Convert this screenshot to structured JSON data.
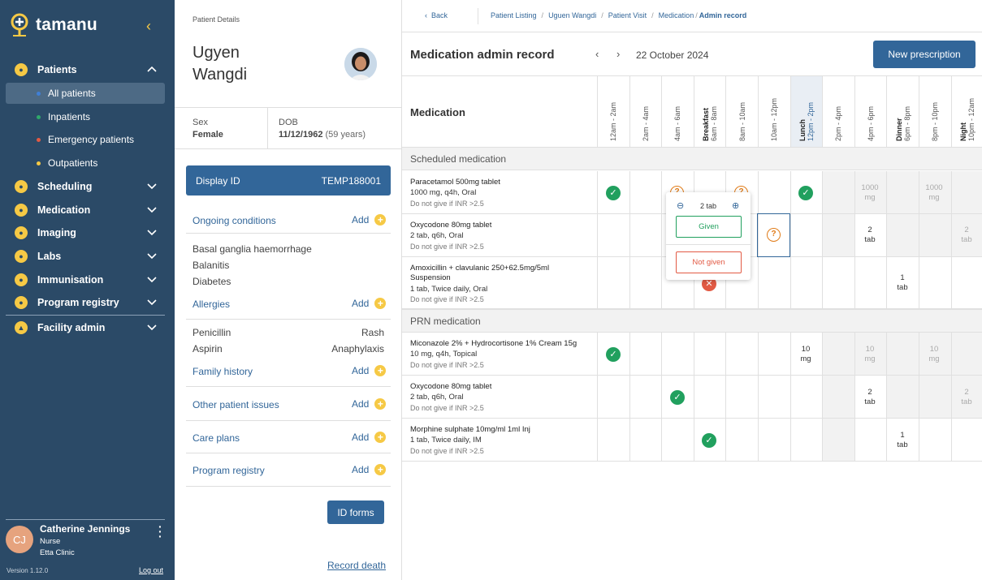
{
  "sidebar": {
    "brand": "tamanu",
    "items": [
      {
        "label": "Patients"
      },
      {
        "label": "Scheduling"
      },
      {
        "label": "Medication"
      },
      {
        "label": "Imaging"
      },
      {
        "label": "Labs"
      },
      {
        "label": "Immunisation"
      },
      {
        "label": "Program registry"
      },
      {
        "label": "Facility admin"
      }
    ],
    "patient_subitems": [
      {
        "label": "All patients",
        "dot_color": "#3f7fd6"
      },
      {
        "label": "Inpatients",
        "dot_color": "#2fa86a"
      },
      {
        "label": "Emergency patients",
        "dot_color": "#e25a44"
      },
      {
        "label": "Outpatients",
        "dot_color": "#f6c945"
      }
    ],
    "user": {
      "initials": "CJ",
      "name": "Catherine Jennings",
      "role": "Nurse",
      "clinic": "Etta Clinic"
    },
    "version": "Version 1.12.0",
    "logout": "Log out"
  },
  "patient": {
    "section_label": "Patient Details",
    "first_name": "Ugyen",
    "last_name": "Wangdi",
    "sex_label": "Sex",
    "sex": "Female",
    "dob_label": "DOB",
    "dob": "11/12/1962",
    "age": "(59 years)",
    "display_id_label": "Display ID",
    "display_id": "TEMP188001",
    "add_label": "Add",
    "ongoing_conditions_title": "Ongoing conditions",
    "conditions": [
      "Basal ganglia haemorrhage",
      "Balanitis",
      "Diabetes"
    ],
    "allergies_title": "Allergies",
    "allergies": [
      {
        "name": "Penicillin",
        "reaction": "Rash"
      },
      {
        "name": "Aspirin",
        "reaction": "Anaphylaxis"
      }
    ],
    "family_history_title": "Family history",
    "other_issues_title": "Other patient issues",
    "care_plans_title": "Care plans",
    "program_registry_title": "Program registry",
    "id_forms": "ID forms",
    "record_death": "Record death"
  },
  "breadcrumb": {
    "back": "Back",
    "items": [
      "Patient Listing",
      "Uguen Wangdi",
      "Patient Visit",
      "Medication"
    ],
    "current": "Admin record"
  },
  "main": {
    "title": "Medication admin record",
    "date": "22 October 2024",
    "new_prescription": "New prescription",
    "medication_header": "Medication",
    "time_columns": [
      {
        "meal": "",
        "time": "12am - 2am"
      },
      {
        "meal": "",
        "time": "2am - 4am"
      },
      {
        "meal": "",
        "time": "4am - 6am"
      },
      {
        "meal": "Breakfast",
        "time": "6am - 8am"
      },
      {
        "meal": "",
        "time": "8am - 10am"
      },
      {
        "meal": "",
        "time": "10am - 12pm"
      },
      {
        "meal": "Lunch",
        "time": "12pm - 2pm"
      },
      {
        "meal": "",
        "time": "2pm - 4pm"
      },
      {
        "meal": "",
        "time": "4pm - 6pm"
      },
      {
        "meal": "Dinner",
        "time": "6pm - 8pm"
      },
      {
        "meal": "",
        "time": "8pm - 10pm"
      },
      {
        "meal": "Night",
        "time": "10pm - 12am"
      }
    ],
    "scheduled_title": "Scheduled medication",
    "prn_title": "PRN medication",
    "scheduled": [
      {
        "name": "Paracetamol 500mg tablet",
        "dose": "1000 mg, q4h, Oral",
        "note": "Do not give if INR >2.5"
      },
      {
        "name": "Oxycodone 80mg tablet",
        "dose": "2 tab, q6h, Oral",
        "note": "Do not give if INR >2.5"
      },
      {
        "name": "Amoxicillin + clavulanic 250+62.5mg/5ml Suspension",
        "dose": "1 tab, Twice daily, Oral",
        "note": "Do not give if INR >2.5"
      }
    ],
    "prn": [
      {
        "name": "Miconazole 2% + Hydrocortisone 1% Cream 15g",
        "dose": "10 mg, q4h, Topical",
        "note": "Do not give if INR >2.5"
      },
      {
        "name": "Oxycodone 80mg tablet",
        "dose": "2 tab, q6h, Oral",
        "note": "Do not give if INR >2.5"
      },
      {
        "name": "Morphine sulphate 10mg/ml 1ml Inj",
        "dose": "1 tab, Twice daily, IM",
        "note": "Do not give if INR >2.5"
      }
    ],
    "qty": {
      "mg1000": "1000",
      "mg": "mg",
      "two": "2",
      "one": "1",
      "ten": "10",
      "tab": "tab"
    },
    "popup": {
      "count": "2 tab",
      "given": "Given",
      "not_given": "Not given"
    }
  }
}
